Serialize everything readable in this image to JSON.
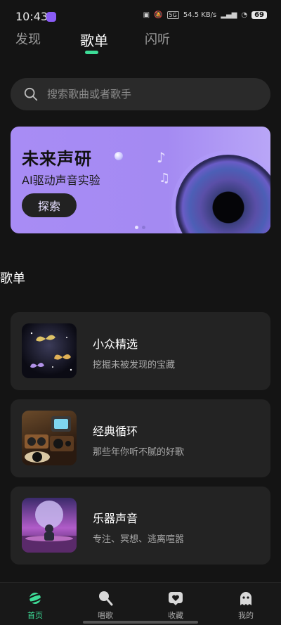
{
  "status_bar": {
    "time": "10:43",
    "network": "5G",
    "speed": "54.5 KB/s",
    "battery": "69"
  },
  "tabs": [
    {
      "label": "发现",
      "active": false
    },
    {
      "label": "歌单",
      "active": true
    },
    {
      "label": "闪听",
      "active": false
    }
  ],
  "search": {
    "placeholder": "搜索歌曲或者歌手"
  },
  "banner": {
    "title": "未来声研",
    "subtitle": "AI驱动声音实验",
    "button": "探索",
    "background": "#a68cf4",
    "page_count": 2,
    "active_page": 1
  },
  "section_title": "歌单",
  "playlists": [
    {
      "name": "小众精选",
      "desc": "挖掘未被发现的宝藏",
      "thumb": "butterflies-image"
    },
    {
      "name": "经典循环",
      "desc": "那些年你听不腻的好歌",
      "thumb": "retro-radio-image"
    },
    {
      "name": "乐器声音",
      "desc": "专注、冥想、逃离喧嚣",
      "thumb": "astronaut-planet-image"
    }
  ],
  "bottom_nav": [
    {
      "label": "首页",
      "icon": "planet-icon",
      "active": true
    },
    {
      "label": "唱歌",
      "icon": "microphone-icon",
      "active": false
    },
    {
      "label": "收藏",
      "icon": "heart-icon",
      "active": false
    },
    {
      "label": "我的",
      "icon": "ghost-icon",
      "active": false
    }
  ],
  "colors": {
    "accent": "#3ddc97",
    "background": "#141414",
    "card": "#232323"
  }
}
